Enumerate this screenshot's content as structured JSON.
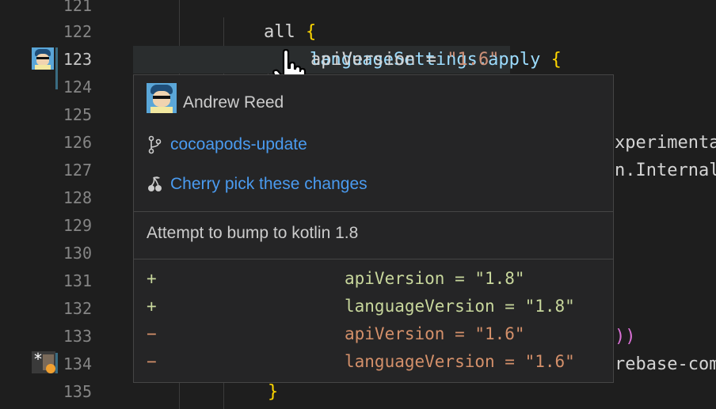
{
  "editor": {
    "line_numbers": [
      "121",
      "122",
      "123",
      "124",
      "125",
      "126",
      "127",
      "128",
      "129",
      "130",
      "131",
      "132",
      "133",
      "134",
      "135"
    ],
    "line121_kw": "all",
    "line121_brace": "{",
    "line122_ident": "languageSettings.apply",
    "line122_brace": "{",
    "line123_prop": "apiVersion",
    "line123_op": " = ",
    "line123_str": "\"1.6\"",
    "right_frag_126": "xperimenta",
    "right_frag_127": "n.Internal",
    "right_frag_133": "))",
    "right_frag_134": "rebase-com",
    "line135_brace": "}"
  },
  "hover": {
    "author": "Andrew Reed",
    "branch": "cocoapods-update",
    "action": "Cherry pick these changes",
    "commit_message": "Attempt to bump to kotlin 1.8",
    "diff": [
      {
        "sign": "+",
        "text": "apiVersion = \"1.8\""
      },
      {
        "sign": "+",
        "text": "languageVersion = \"1.8\""
      },
      {
        "sign": "−",
        "text": "apiVersion = \"1.6\""
      },
      {
        "sign": "−",
        "text": "languageVersion = \"1.6\""
      }
    ]
  },
  "icons": {
    "branch": "git-branch-icon",
    "cherry": "cherry-icon",
    "pointer": "hand-pointer-icon"
  },
  "colors": {
    "link": "#4a9bf0",
    "added": "#c8d79c",
    "removed": "#d4906a",
    "gutter_marker": "#3a6c82",
    "status_dot": "#f0a030"
  }
}
